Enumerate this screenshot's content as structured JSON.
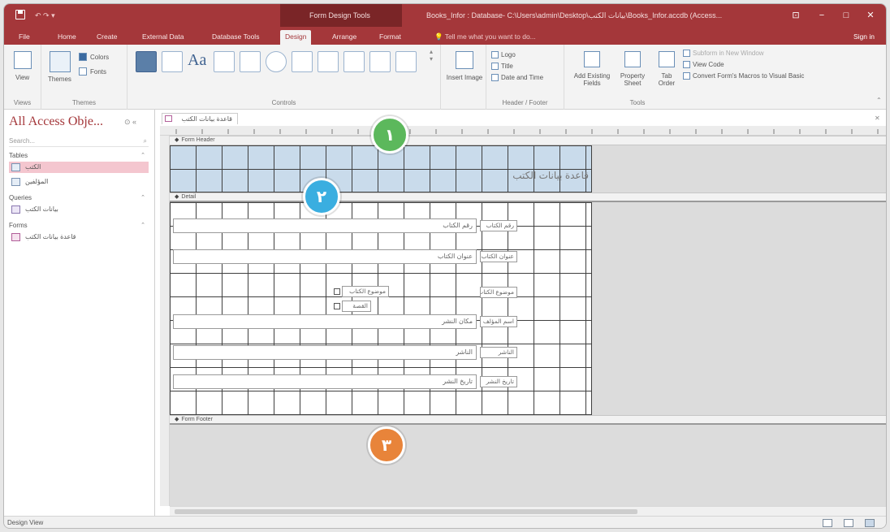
{
  "window": {
    "title": "Books_Infor : Database- C:\\Users\\admin\\Desktop\\بيانات الكتب\\Books_Infor.accdb (Access...",
    "contextual_tab_group": "Form Design Tools",
    "sign_in": "Sign in",
    "tell_me": "Tell me what you want to do..."
  },
  "ribbon_tabs": [
    "File",
    "Home",
    "Create",
    "External Data",
    "Database Tools",
    "Design",
    "Arrange",
    "Format"
  ],
  "active_tab": "Design",
  "ribbon": {
    "views": {
      "label": "View",
      "group_label": "Views"
    },
    "themes": {
      "label": "Themes",
      "colors": "Colors",
      "fonts": "Fonts",
      "group_label": "Themes"
    },
    "controls": {
      "group_label": "Controls"
    },
    "insert_image": "Insert Image",
    "header_footer": {
      "logo": "Logo",
      "title": "Title",
      "date_time": "Date and Time",
      "group_label": "Header / Footer"
    },
    "tools": {
      "add_existing_fields": "Add Existing Fields",
      "property_sheet": "Property Sheet",
      "tab_order": "Tab Order",
      "subform_new_window": "Subform in New Window",
      "view_code": "View Code",
      "convert_macros": "Convert Form's Macros to Visual Basic",
      "group_label": "Tools"
    }
  },
  "nav": {
    "title": "All Access Obje...",
    "search_placeholder": "Search...",
    "groups": [
      {
        "header": "Tables",
        "items": [
          "الكتب",
          "المؤلفين"
        ]
      },
      {
        "header": "Queries",
        "items": [
          "بيانات الكتب"
        ]
      },
      {
        "header": "Forms",
        "items": [
          "قاعدة بيانات الكتب"
        ]
      }
    ],
    "selected_item": "الكتب"
  },
  "document": {
    "tab_label": "قاعدة بيانات الكتب",
    "sections": {
      "header": "Form Header",
      "detail": "Detail",
      "footer": "Form Footer"
    },
    "header_title": "قاعدة بيانات الكتب",
    "fields": [
      {
        "label": "رقم الكتاب",
        "control": "رقم الكتاب"
      },
      {
        "label": "عنوان الكتاب",
        "control": "عنوان الكتاب"
      },
      {
        "label": "موضوع الكتاب",
        "control": ""
      },
      {
        "label": "اسم المؤلف",
        "control": "مكان النشر"
      },
      {
        "label": "الناشر",
        "control": "الناشر"
      },
      {
        "label": "تاريخ النشر",
        "control": "تاريخ النشر"
      }
    ],
    "check_options": [
      "موضوع الكتاب",
      "القصة"
    ]
  },
  "callouts": [
    "١",
    "٢",
    "٣"
  ],
  "callout_colors": [
    "#5cb85c",
    "#3aaee0",
    "#e8843a"
  ],
  "status": {
    "text": "Design View"
  }
}
